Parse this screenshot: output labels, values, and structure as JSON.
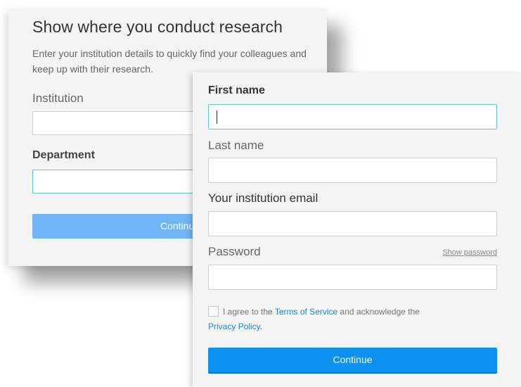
{
  "research_card": {
    "title": "Show where you conduct research",
    "description": "Enter your institution details to quickly find your colleagues and keep up with their research.",
    "institution_label": "Institution",
    "institution_value": "",
    "department_label": "Department",
    "department_value": "",
    "continue_label": "Continue"
  },
  "signup_card": {
    "first_name_label": "First name",
    "first_name_value": "",
    "last_name_label": "Last name",
    "last_name_value": "",
    "email_label": "Your institution email",
    "email_value": "",
    "password_label": "Password",
    "password_value": "",
    "show_password_label": "Show password",
    "agree_prefix": "I agree to the ",
    "terms_label": "Terms of Service",
    "agree_middle": " and acknowledge the ",
    "privacy_label": "Privacy Policy",
    "agree_suffix": ".",
    "agree_checked": false,
    "continue_label": "Continue"
  },
  "colors": {
    "primary_button": "#0d91f0",
    "back_button": "#70b6f6",
    "focus_border": "#5fc7d2",
    "link": "#1789c8"
  }
}
